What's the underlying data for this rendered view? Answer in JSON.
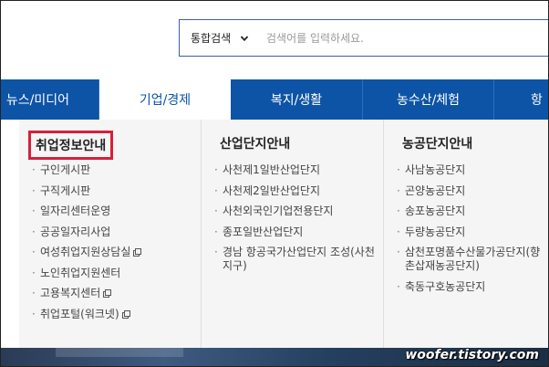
{
  "search": {
    "category": "통합검색",
    "placeholder": "검색어를 입력하세요."
  },
  "nav": {
    "items": [
      {
        "label": "뉴스/미디어"
      },
      {
        "label": "기업/경제"
      },
      {
        "label": "복지/생활"
      },
      {
        "label": "농수산/체험"
      },
      {
        "label": "항"
      }
    ],
    "active_index": 1
  },
  "dropdown": {
    "columns": [
      {
        "title": "취업정보안내",
        "items": [
          {
            "label": "구인게시판",
            "external": false
          },
          {
            "label": "구직게시판",
            "external": false
          },
          {
            "label": "일자리센터운영",
            "external": false
          },
          {
            "label": "공공일자리사업",
            "external": false
          },
          {
            "label": "여성취업지원상담실",
            "external": true
          },
          {
            "label": "노인취업지원센터",
            "external": false
          },
          {
            "label": "고용복지센터",
            "external": true
          },
          {
            "label": "취업포털(워크넷)",
            "external": true
          }
        ]
      },
      {
        "title": "산업단지안내",
        "items": [
          {
            "label": "사천제1일반산업단지",
            "external": false
          },
          {
            "label": "사천제2일반산업단지",
            "external": false
          },
          {
            "label": "사천외국인기업전용단지",
            "external": false
          },
          {
            "label": "종포일반산업단지",
            "external": false
          },
          {
            "label": "경남 항공국가산업단지 조성(사천지구)",
            "external": false
          }
        ]
      },
      {
        "title": "농공단지안내",
        "items": [
          {
            "label": "사남농공단지",
            "external": false
          },
          {
            "label": "곤양농공단지",
            "external": false
          },
          {
            "label": "송포농공단지",
            "external": false
          },
          {
            "label": "두량농공단지",
            "external": false
          },
          {
            "label": "삼천포명품수산물가공단지(향촌삽재농공단지)",
            "external": false
          },
          {
            "label": "축동구호농공단지",
            "external": false
          }
        ]
      }
    ]
  },
  "watermark": "woofer.tistory.com",
  "colors": {
    "nav_bg": "#0d54a6",
    "highlight_border": "#d6203a"
  },
  "icons": {
    "select_chevron": "chevron-down-icon",
    "external_link": "external-link-icon"
  }
}
